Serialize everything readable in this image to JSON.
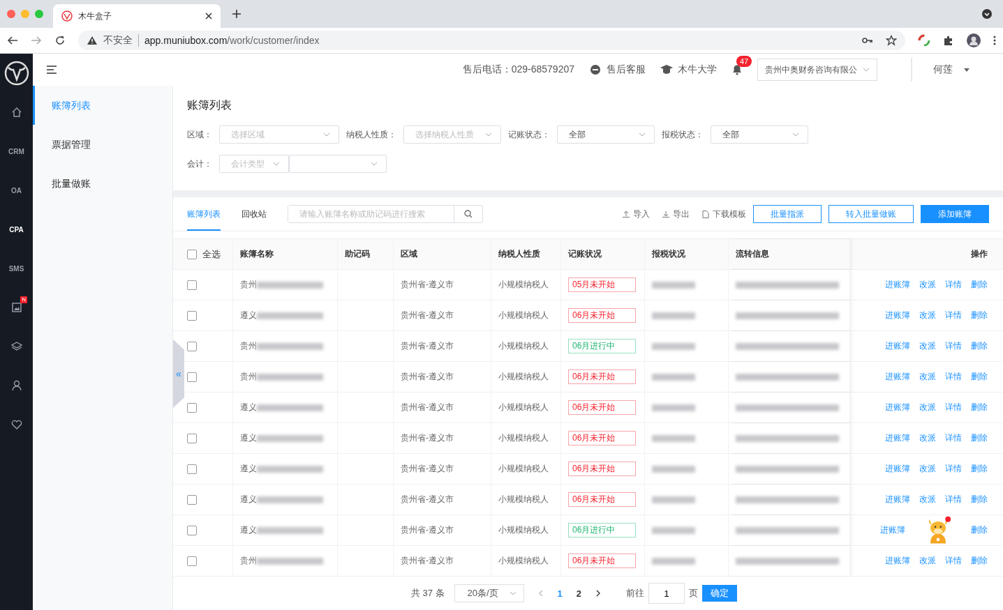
{
  "browser": {
    "tab_title": "木牛盒子",
    "security": "不安全",
    "url_host": "app.muniubox.com",
    "url_path": "/work/customer/index"
  },
  "rail": [
    {
      "kind": "home",
      "selected": false
    },
    {
      "kind": "text",
      "label": "CRM",
      "selected": false
    },
    {
      "kind": "text",
      "label": "OA",
      "selected": false
    },
    {
      "kind": "text",
      "label": "CPA",
      "selected": true
    },
    {
      "kind": "text",
      "label": "SMS",
      "selected": false
    },
    {
      "kind": "image",
      "badge": "N",
      "selected": false
    },
    {
      "kind": "layers",
      "selected": false
    },
    {
      "kind": "user",
      "selected": false
    },
    {
      "kind": "heart",
      "selected": false
    }
  ],
  "collapse_handle": "«",
  "header": {
    "phone": "售后电话：029-68579207",
    "service": "售后客服",
    "university": "木牛大学",
    "notifications": "47",
    "company": "贵州中奥财务咨询有限公",
    "user": "何莲"
  },
  "sidebar": {
    "items": [
      {
        "label": "账簿列表",
        "selected": true
      },
      {
        "label": "票据管理",
        "selected": false
      },
      {
        "label": "批量做账",
        "selected": false
      }
    ]
  },
  "page_title": "账簿列表",
  "filters": [
    {
      "label": "区域：",
      "placeholder": "选择区域"
    },
    {
      "label": "纳税人性质：",
      "placeholder": "选择纳税人性质"
    },
    {
      "label": "记账状态：",
      "value": "全部"
    },
    {
      "label": "报税状态：",
      "value": "全部"
    }
  ],
  "accountant": {
    "label": "会计：",
    "placeholder": "会计类型"
  },
  "tabs": [
    {
      "label": "账簿列表",
      "selected": true
    },
    {
      "label": "回收站",
      "selected": false
    }
  ],
  "search": {
    "placeholder": "请输入账簿名称或助记码进行搜索"
  },
  "toolbar": {
    "links": [
      {
        "kind": "upload",
        "label": "导入"
      },
      {
        "kind": "download",
        "label": "导出"
      },
      {
        "kind": "file",
        "label": "下载模板"
      }
    ],
    "buttons": [
      {
        "label": "批量指派",
        "primary": false
      },
      {
        "label": "转入批量做账",
        "primary": false
      },
      {
        "label": "添加账簿",
        "primary": true
      }
    ]
  },
  "table": {
    "select_all": {
      "label": "全选",
      "checked": false
    },
    "columns": [
      "账簿名称",
      "助记码",
      "区域",
      "纳税人性质",
      "记账状况",
      "报税状况",
      "流转信息",
      "操作"
    ],
    "rows": [
      {
        "checked": false,
        "name": "贵州",
        "region": "贵州省-遵义市",
        "taxpayer": "小规模纳税人",
        "status": {
          "kind": "not_started",
          "label": "05月未开始"
        },
        "actions": [
          {
            "kind": "link",
            "label": "进账簿"
          },
          {
            "kind": "link",
            "label": "改派"
          },
          {
            "kind": "link",
            "label": "详情"
          },
          {
            "kind": "link",
            "label": "删除"
          }
        ]
      },
      {
        "checked": false,
        "name": "遵义",
        "region": "贵州省-遵义市",
        "taxpayer": "小规模纳税人",
        "status": {
          "kind": "not_started",
          "label": "06月未开始"
        },
        "actions": [
          {
            "kind": "link",
            "label": "进账簿"
          },
          {
            "kind": "link",
            "label": "改派"
          },
          {
            "kind": "link",
            "label": "详情"
          },
          {
            "kind": "link",
            "label": "删除"
          }
        ]
      },
      {
        "checked": false,
        "name": "贵州",
        "region": "贵州省-遵义市",
        "taxpayer": "小规模纳税人",
        "status": {
          "kind": "in_progress",
          "label": "06月进行中"
        },
        "actions": [
          {
            "kind": "link",
            "label": "进账簿"
          },
          {
            "kind": "link",
            "label": "改派"
          },
          {
            "kind": "link",
            "label": "详情"
          },
          {
            "kind": "link",
            "label": "删除"
          }
        ]
      },
      {
        "checked": false,
        "name": "贵州",
        "region": "贵州省-遵义市",
        "taxpayer": "小规模纳税人",
        "status": {
          "kind": "not_started",
          "label": "06月未开始"
        },
        "actions": [
          {
            "kind": "link",
            "label": "进账簿"
          },
          {
            "kind": "link",
            "label": "改派"
          },
          {
            "kind": "link",
            "label": "详情"
          },
          {
            "kind": "link",
            "label": "删除"
          }
        ]
      },
      {
        "checked": false,
        "name": "遵义",
        "region": "贵州省-遵义市",
        "taxpayer": "小规模纳税人",
        "status": {
          "kind": "not_started",
          "label": "06月未开始"
        },
        "actions": [
          {
            "kind": "link",
            "label": "进账簿"
          },
          {
            "kind": "link",
            "label": "改派"
          },
          {
            "kind": "link",
            "label": "详情"
          },
          {
            "kind": "link",
            "label": "删除"
          }
        ]
      },
      {
        "checked": false,
        "name": "遵义",
        "region": "贵州省-遵义市",
        "taxpayer": "小规模纳税人",
        "status": {
          "kind": "not_started",
          "label": "06月未开始"
        },
        "actions": [
          {
            "kind": "link",
            "label": "进账簿"
          },
          {
            "kind": "link",
            "label": "改派"
          },
          {
            "kind": "link",
            "label": "详情"
          },
          {
            "kind": "link",
            "label": "删除"
          }
        ]
      },
      {
        "checked": false,
        "name": "遵义",
        "region": "贵州省-遵义市",
        "taxpayer": "小规模纳税人",
        "status": {
          "kind": "not_started",
          "label": "06月未开始"
        },
        "actions": [
          {
            "kind": "link",
            "label": "进账簿"
          },
          {
            "kind": "link",
            "label": "改派"
          },
          {
            "kind": "link",
            "label": "详情"
          },
          {
            "kind": "link",
            "label": "删除"
          }
        ]
      },
      {
        "checked": false,
        "name": "遵义",
        "region": "贵州省-遵义市",
        "taxpayer": "小规模纳税人",
        "status": {
          "kind": "not_started",
          "label": "06月未开始"
        },
        "actions": [
          {
            "kind": "link",
            "label": "进账簿"
          },
          {
            "kind": "link",
            "label": "改派"
          },
          {
            "kind": "link",
            "label": "详情"
          },
          {
            "kind": "link",
            "label": "删除"
          }
        ]
      },
      {
        "checked": false,
        "name": "遵义",
        "region": "贵州省-遵义市",
        "taxpayer": "小规模纳税人",
        "status": {
          "kind": "in_progress",
          "label": "06月进行中"
        },
        "actions": [
          {
            "kind": "link",
            "label": "进账簿"
          },
          {
            "kind": "mascot"
          },
          {
            "kind": "link",
            "label": "删除"
          }
        ]
      },
      {
        "checked": false,
        "name": "贵州",
        "region": "贵州省-遵义市",
        "taxpayer": "小规模纳税人",
        "status": {
          "kind": "not_started",
          "label": "06月未开始"
        },
        "actions": [
          {
            "kind": "link",
            "label": "进账簿"
          },
          {
            "kind": "link",
            "label": "改派"
          },
          {
            "kind": "link",
            "label": "详情"
          },
          {
            "kind": "link",
            "label": "删除"
          }
        ]
      }
    ]
  },
  "pagination": {
    "total": "共 37 条",
    "page_size": "20条/页",
    "pages": [
      {
        "label": "1",
        "selected": true
      },
      {
        "label": "2",
        "selected": false
      }
    ],
    "goto_label": "前往",
    "goto_value": "1",
    "page_unit": "页",
    "confirm": "确定"
  }
}
